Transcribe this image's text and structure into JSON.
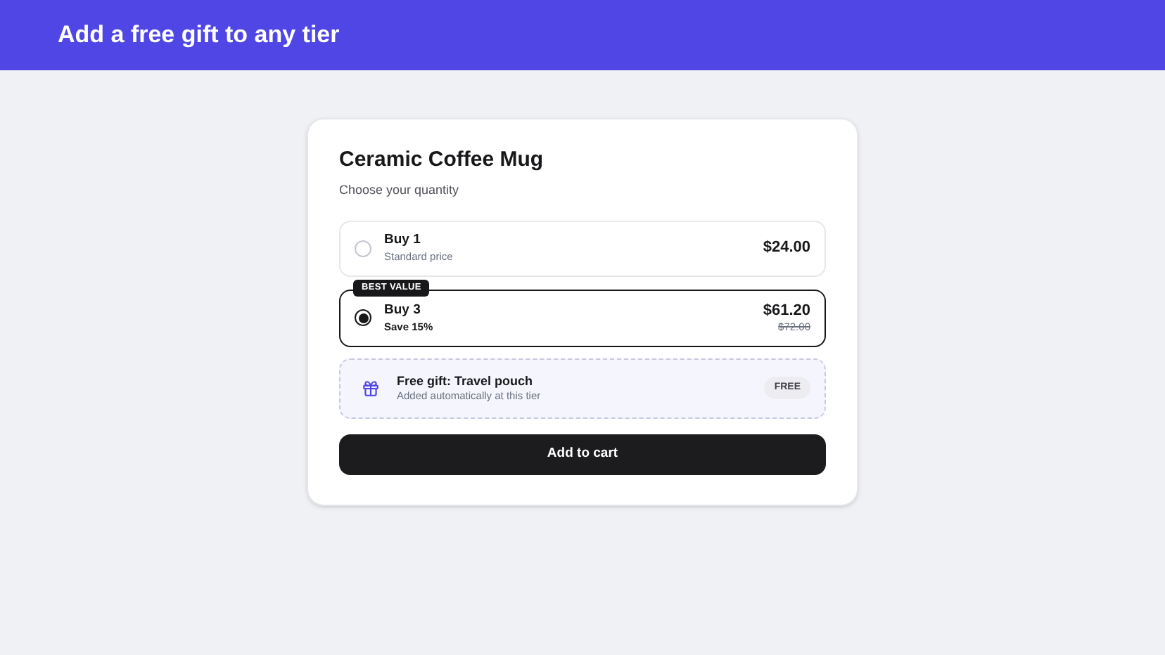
{
  "header": {
    "title": "Add a free gift to any tier"
  },
  "card": {
    "title": "Ceramic Coffee Mug",
    "subtitle": "Choose your quantity",
    "options": [
      {
        "label": "Buy 1",
        "note": "Standard price",
        "price": "$24.00",
        "selected": false
      },
      {
        "label": "Buy 3",
        "note": "Save 15%",
        "price": "$61.20",
        "old_price": "$72.00",
        "badge": "BEST VALUE",
        "selected": true
      }
    ],
    "gift": {
      "title": "Free gift: Travel pouch",
      "note": "Added automatically at this tier",
      "tag": "FREE"
    },
    "button": "Add to cart"
  }
}
